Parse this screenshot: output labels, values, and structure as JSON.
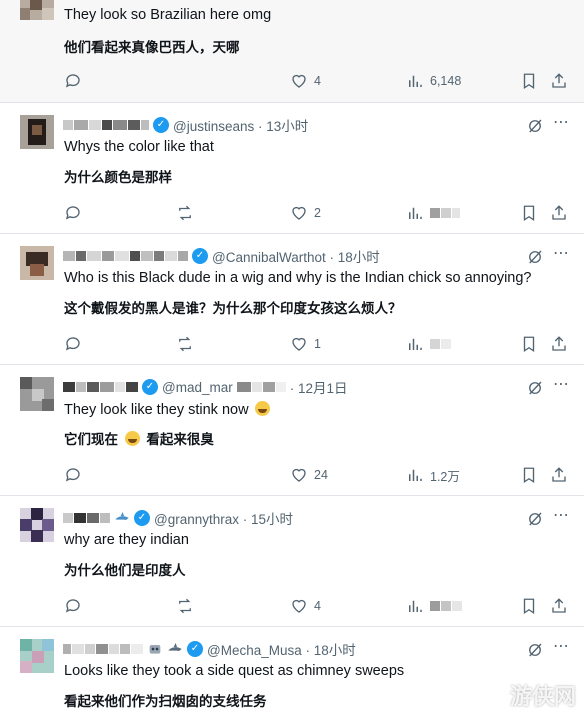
{
  "tweets": [
    {
      "handle": "",
      "time": "",
      "text_en": "They look so Brazilian here omg",
      "text_zh": "他们看起来真像巴西人，天哪",
      "stats": {
        "reply": "",
        "repost": "",
        "like": "4",
        "views": "6,148"
      }
    },
    {
      "handle": "@justinseans · 13小时",
      "text_en": "Whys the color like that",
      "text_zh": "为什么颜色是那样",
      "stats": {
        "reply": "",
        "repost": "",
        "like": "2",
        "views": ""
      }
    },
    {
      "handle": "@CannibalWarthot · 18小时",
      "text_en": "Who is this Black dude in a wig and why is the Indian chick so annoying?",
      "text_zh": "这个戴假发的黑人是谁？为什么那个印度女孩这么烦人？",
      "stats": {
        "reply": "",
        "repost": "",
        "like": "1",
        "views": ""
      }
    },
    {
      "handle": "@mad_mar",
      "time": "· 12月1日",
      "text_en": "They look like they stink now",
      "text_zh_before": "它们现在",
      "text_zh_after": "看起来很臭",
      "stats": {
        "reply": "",
        "repost": "",
        "like": "24",
        "views": "1.2万"
      }
    },
    {
      "handle": "@grannythrax · 15小时",
      "text_en": "why are they indian",
      "text_zh": "为什么他们是印度人",
      "stats": {
        "reply": "",
        "repost": "",
        "like": "4",
        "views": ""
      }
    },
    {
      "handle": "@Mecha_Musa · 18小时",
      "text_en": "Looks like they took a side quest as chimney sweeps",
      "text_zh": "看起来他们作为扫烟囱的支线任务",
      "stats": {}
    }
  ],
  "watermark": "游侠网",
  "icons": [
    "reply-icon",
    "repost-icon",
    "like-icon",
    "views-icon",
    "bookmark-icon",
    "share-icon",
    "grok-icon",
    "more-icon",
    "verified-badge"
  ],
  "colors": {
    "verified": "#1d9bf0",
    "muted": "#536471",
    "text": "#0f1419",
    "divider": "#e1e5e9"
  }
}
